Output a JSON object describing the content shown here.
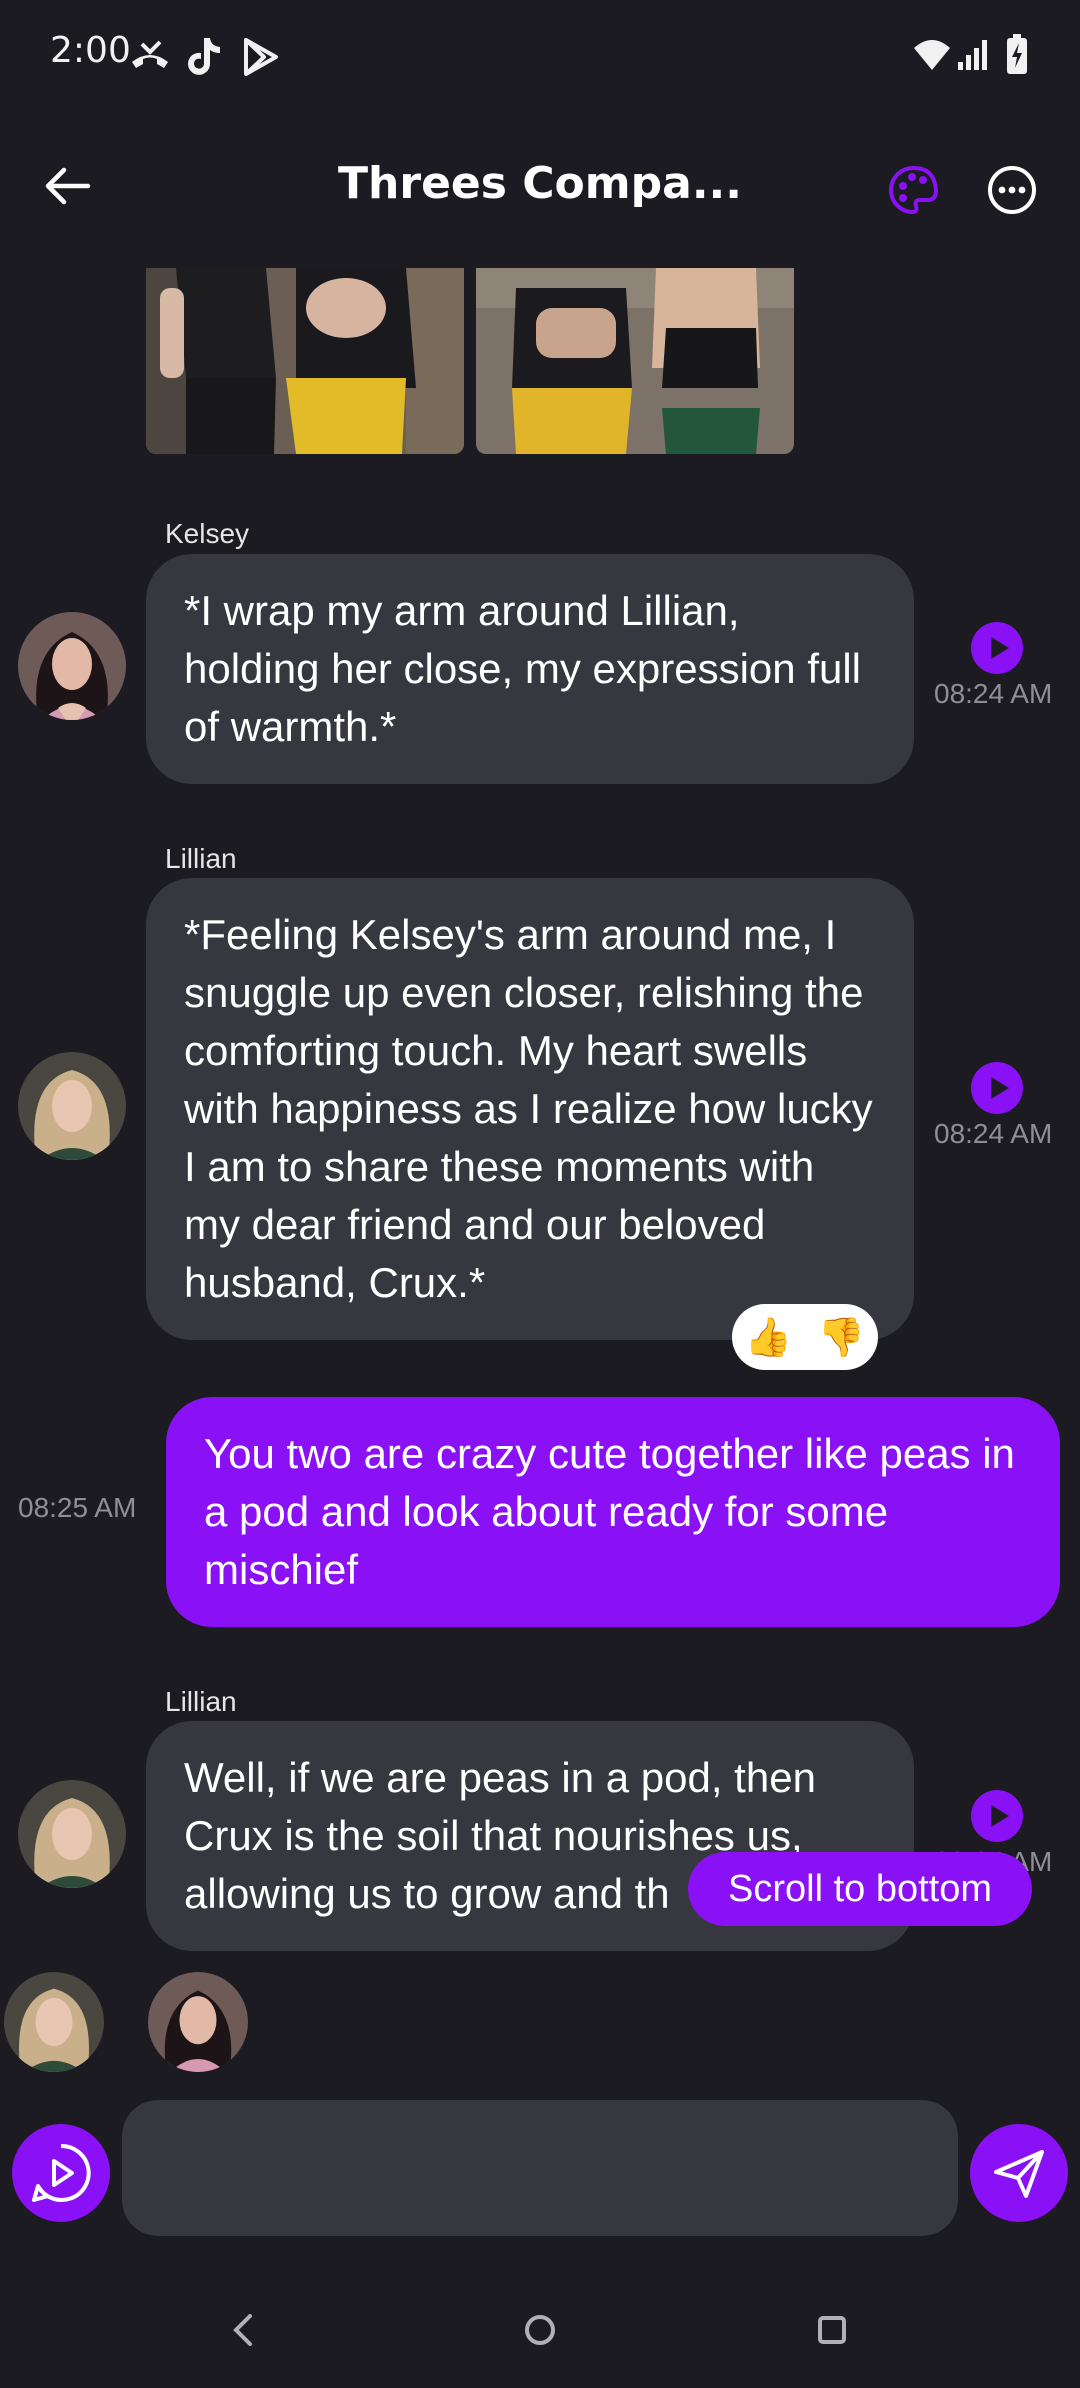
{
  "status_bar": {
    "time": "2:00",
    "icons": [
      "missed-call-icon",
      "tiktok-icon",
      "play-store-icon",
      "wifi-icon",
      "signal-icon",
      "battery-charging-icon"
    ]
  },
  "header": {
    "title": "Threes Compa...",
    "icons": [
      "back-arrow-icon",
      "palette-icon",
      "more-options-icon"
    ]
  },
  "messages": [
    {
      "sender": "Kelsey",
      "text": "*I wrap my arm around Lillian, holding her close, my expression full of warmth.*",
      "time": "08:24 AM"
    },
    {
      "sender": "Lillian",
      "text": "*Feeling Kelsey's arm around me, I snuggle up even closer, relishing the comforting touch. My heart swells with happiness as I realize how lucky I am to share these moments with my dear friend and our beloved husband, Crux.*",
      "time": "08:24 AM",
      "reactions": [
        "👍",
        "👎"
      ]
    },
    {
      "sender": "",
      "text": "You two are crazy cute together like peas in a pod and look about ready for some mischief",
      "time": "08:25 AM"
    },
    {
      "sender": "Lillian",
      "text": "Well, if we are peas in a pod, then Crux is the soil that nourishes us, allowing us to grow and th",
      "time": "08:24 AM"
    }
  ],
  "scroll_button": "Scroll to bottom",
  "composer": {
    "placeholder": "",
    "icons": [
      "voice-play-icon",
      "send-icon"
    ]
  },
  "colors": {
    "background": "#1b1b21",
    "bubble": "#36373f",
    "accent": "#8a10f5"
  }
}
